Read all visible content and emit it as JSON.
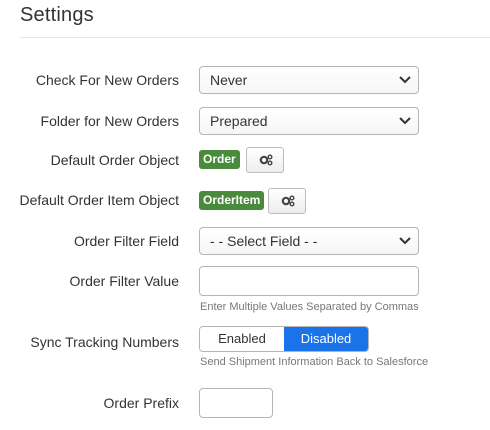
{
  "page": {
    "title": "Settings"
  },
  "fields": {
    "check_new_orders": {
      "label": "Check For New Orders",
      "value": "Never"
    },
    "folder_new_orders": {
      "label": "Folder for New Orders",
      "value": "Prepared"
    },
    "default_order_object": {
      "label": "Default Order Object",
      "badge": "Order",
      "icon": "gears-icon"
    },
    "default_order_item_object": {
      "label": "Default Order Item Object",
      "badge": "OrderItem",
      "icon": "gears-icon"
    },
    "order_filter_field": {
      "label": "Order Filter Field",
      "value": "- - Select Field - -"
    },
    "order_filter_value": {
      "label": "Order Filter Value",
      "value": "",
      "help": "Enter Multiple Values Separated by Commas"
    },
    "sync_tracking_numbers": {
      "label": "Sync Tracking Numbers",
      "options": [
        "Enabled",
        "Disabled"
      ],
      "selected": "Disabled",
      "help": "Send Shipment Information Back to Salesforce"
    },
    "order_prefix": {
      "label": "Order Prefix",
      "value": ""
    }
  },
  "colors": {
    "badge": "#4a8a3d",
    "toggle_active": "#1a73e8"
  }
}
